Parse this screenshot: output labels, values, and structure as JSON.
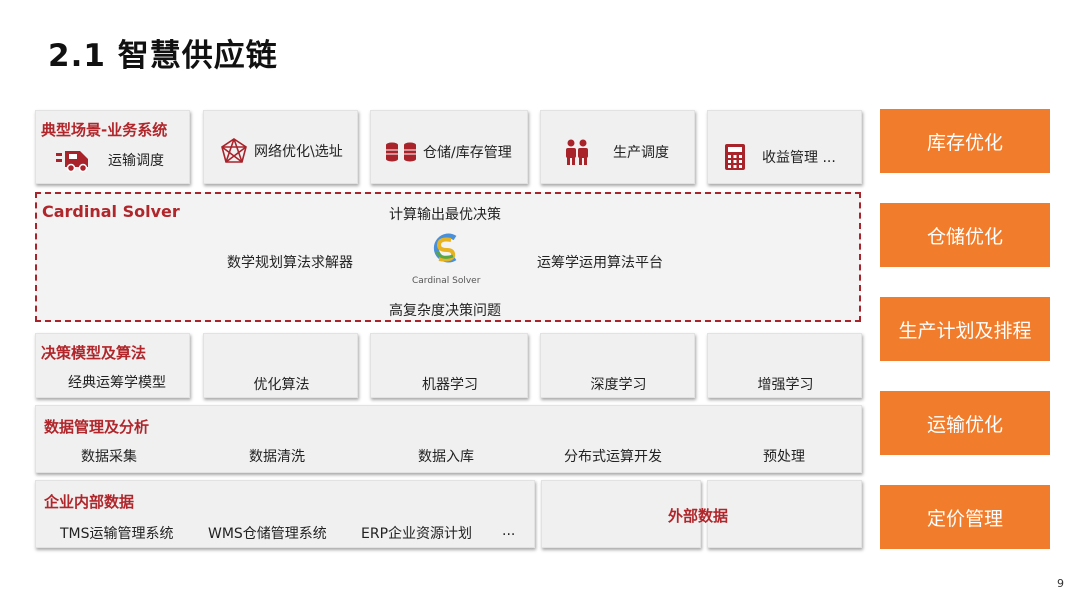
{
  "page": {
    "title": "2.1 智慧供应链",
    "number": "9"
  },
  "scenarios": {
    "header": "典型场景-业务系统",
    "items": [
      {
        "label": "运输调度",
        "icon": "truck-icon"
      },
      {
        "label": "网络优化\\选址",
        "icon": "network-icon"
      },
      {
        "label": "仓储/库存管理",
        "icon": "database-icon"
      },
      {
        "label": "生产调度",
        "icon": "workers-icon"
      },
      {
        "label": "收益管理 ...",
        "icon": "calculator-icon"
      }
    ]
  },
  "solver": {
    "header": "Cardinal Solver",
    "top": "计算输出最优决策",
    "left": "数学规划算法求解器",
    "right": "运筹学运用算法平台",
    "bottom": "高复杂度决策问题",
    "logo_text": "Cardinal Solver"
  },
  "models": {
    "header": "决策模型及算法",
    "items": [
      "经典运筹学模型",
      "优化算法",
      "机器学习",
      "深度学习",
      "增强学习"
    ]
  },
  "data_mgmt": {
    "header": "数据管理及分析",
    "items": [
      "数据采集",
      "数据清洗",
      "数据入库",
      "分布式运算开发",
      "预处理"
    ]
  },
  "internal": {
    "header": "企业内部数据",
    "items": [
      "TMS运输管理系统",
      "WMS仓储管理系统",
      "ERP企业资源计划",
      "..."
    ]
  },
  "external": {
    "label": "外部数据"
  },
  "right_panel": [
    "库存优化",
    "仓储优化",
    "生产计划及排程",
    "运输优化",
    "定价管理"
  ],
  "colors": {
    "accent_red": "#b0262b",
    "orange": "#f07c2c",
    "box_bg": "#f0f0f0"
  }
}
